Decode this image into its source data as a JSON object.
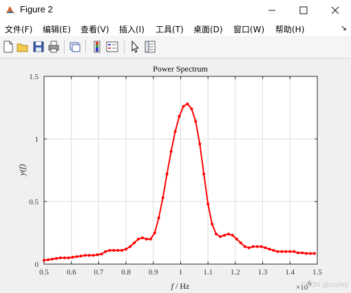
{
  "window": {
    "title": "Figure 2"
  },
  "menu": [
    "文件(F)",
    "编辑(E)",
    "查看(V)",
    "插入(I)",
    "工具(T)",
    "桌面(D)",
    "窗口(W)",
    "帮助(H)"
  ],
  "toolbar": [
    "new-figure-icon",
    "open-file-icon",
    "save-icon",
    "print-icon",
    "link-plot-icon",
    "colorbar-icon",
    "legend-icon",
    "pointer-icon",
    "property-inspector-icon"
  ],
  "chart_data": {
    "type": "line",
    "title": "Power Spectrum",
    "xlabel_italic": "f",
    "xlabel_rest": " / Hz",
    "ylabel": "y(f)",
    "exponent_base": "×10",
    "exponent_power": "6",
    "xlim": [
      0.5,
      1.5
    ],
    "ylim": [
      0,
      1.5
    ],
    "xticks": [
      "0.5",
      "0.6",
      "0.7",
      "0.8",
      "0.9",
      "1",
      "1.1",
      "1.2",
      "1.3",
      "1.4",
      "1.5"
    ],
    "yticks": [
      "0",
      "0.5",
      "1",
      "1.5"
    ],
    "grid": true,
    "color": "#ff0000",
    "x": [
      0.5,
      0.515,
      0.53,
      0.545,
      0.56,
      0.575,
      0.59,
      0.605,
      0.62,
      0.635,
      0.65,
      0.665,
      0.68,
      0.695,
      0.71,
      0.725,
      0.74,
      0.755,
      0.77,
      0.785,
      0.8,
      0.815,
      0.83,
      0.845,
      0.86,
      0.875,
      0.89,
      0.905,
      0.92,
      0.935,
      0.95,
      0.965,
      0.98,
      0.995,
      1.01,
      1.025,
      1.04,
      1.055,
      1.07,
      1.085,
      1.1,
      1.115,
      1.13,
      1.145,
      1.16,
      1.175,
      1.19,
      1.205,
      1.22,
      1.235,
      1.25,
      1.265,
      1.28,
      1.295,
      1.31,
      1.325,
      1.34,
      1.355,
      1.37,
      1.385,
      1.4,
      1.415,
      1.43,
      1.445,
      1.46,
      1.475,
      1.49
    ],
    "y": [
      0.03,
      0.035,
      0.04,
      0.045,
      0.05,
      0.05,
      0.05,
      0.055,
      0.06,
      0.065,
      0.07,
      0.07,
      0.07,
      0.075,
      0.08,
      0.1,
      0.11,
      0.11,
      0.11,
      0.11,
      0.12,
      0.14,
      0.17,
      0.2,
      0.21,
      0.2,
      0.2,
      0.25,
      0.37,
      0.53,
      0.72,
      0.9,
      1.06,
      1.18,
      1.26,
      1.28,
      1.24,
      1.14,
      0.96,
      0.72,
      0.48,
      0.32,
      0.24,
      0.22,
      0.23,
      0.24,
      0.23,
      0.2,
      0.17,
      0.14,
      0.13,
      0.14,
      0.14,
      0.14,
      0.13,
      0.12,
      0.11,
      0.1,
      0.1,
      0.1,
      0.1,
      0.1,
      0.09,
      0.09,
      0.085,
      0.085,
      0.085
    ]
  },
  "watermark": "CSDN @cxylay"
}
